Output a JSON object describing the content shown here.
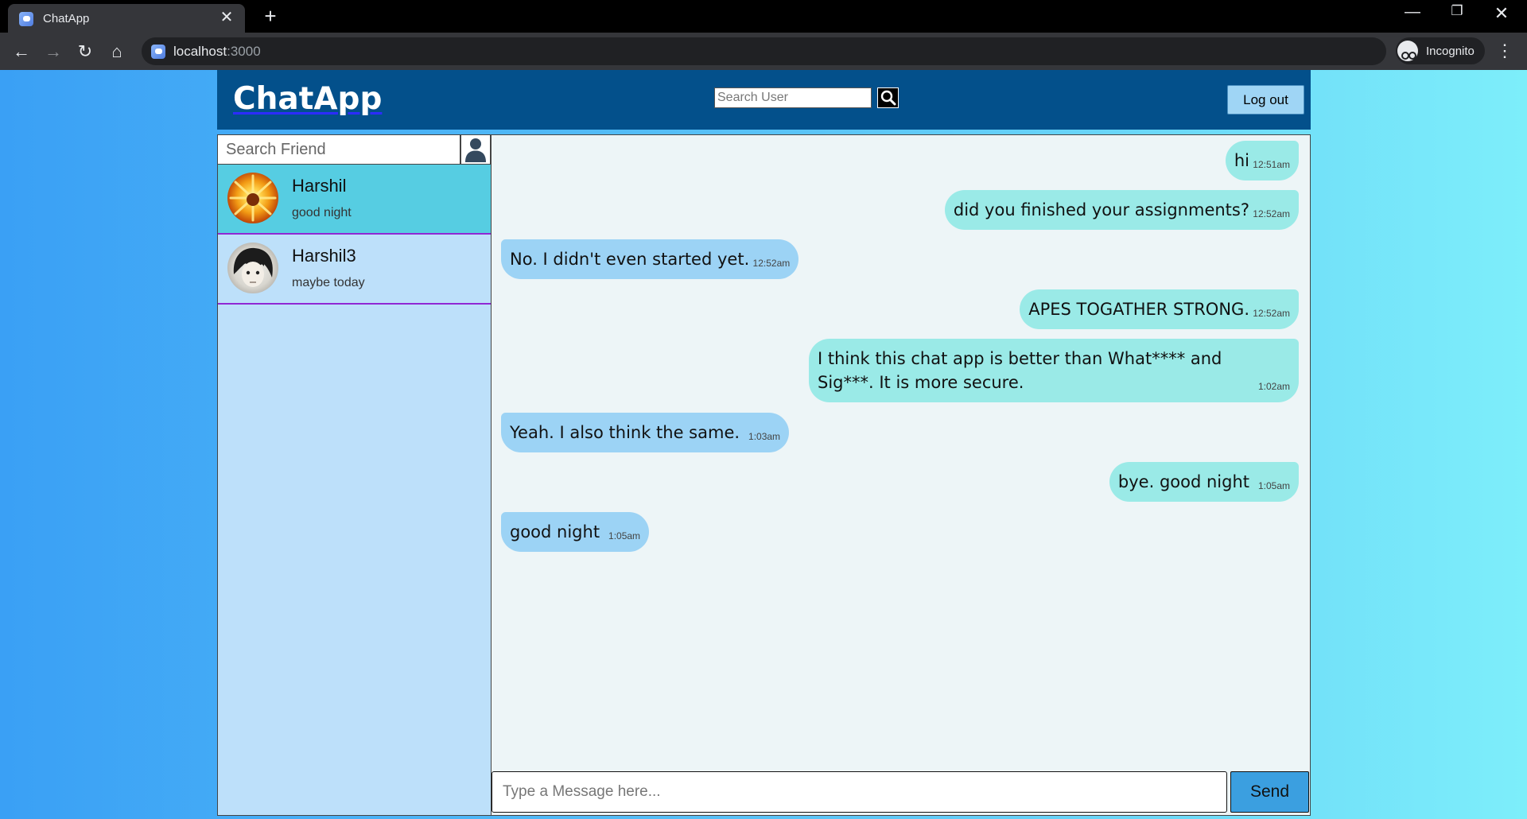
{
  "browser": {
    "tab_title": "ChatApp",
    "tab_close": "✕",
    "new_tab": "+",
    "url_host": "localhost",
    "url_port": ":3000",
    "profile_label": "Incognito",
    "menu": "⋮",
    "back": "←",
    "forward": "→",
    "reload": "↻",
    "home": "⌂",
    "minimize": "—",
    "restore": "❐",
    "close": "✕"
  },
  "header": {
    "logo": "ChatApp",
    "search_placeholder": "Search User",
    "logout_label": "Log out"
  },
  "sidebar": {
    "search_placeholder": "Search Friend",
    "contacts": [
      {
        "name": "Harshil",
        "last_message": "good night",
        "selected": true
      },
      {
        "name": "Harshil3",
        "last_message": "maybe today",
        "selected": false
      }
    ]
  },
  "chat": {
    "messages": [
      {
        "text": "hi",
        "time": "12:51am",
        "direction": "out"
      },
      {
        "text": "did you finished your assignments?",
        "time": "12:52am",
        "direction": "out"
      },
      {
        "text": "No. I didn't even started yet.",
        "time": "12:52am",
        "direction": "in"
      },
      {
        "text": "APES TOGATHER STRONG.",
        "time": "12:52am",
        "direction": "out"
      },
      {
        "text": "I think this chat app is better than What**** and Sig***. It is more secure.",
        "time": "1:02am",
        "direction": "out"
      },
      {
        "text": "Yeah. I also think the same.",
        "time": "1:03am",
        "direction": "in"
      },
      {
        "text": "bye. good night",
        "time": "1:05am",
        "direction": "out"
      },
      {
        "text": "good night",
        "time": "1:05am",
        "direction": "in"
      }
    ],
    "input_placeholder": "Type a Message here...",
    "send_label": "Send"
  },
  "colors": {
    "header_bg": "#03508b",
    "sidebar_bg": "#bde0fa",
    "selected_contact": "#56cde2",
    "outgoing_bubble": "#9aeae7",
    "incoming_bubble": "#9cd3f5",
    "send_button": "#3b9fe0"
  }
}
